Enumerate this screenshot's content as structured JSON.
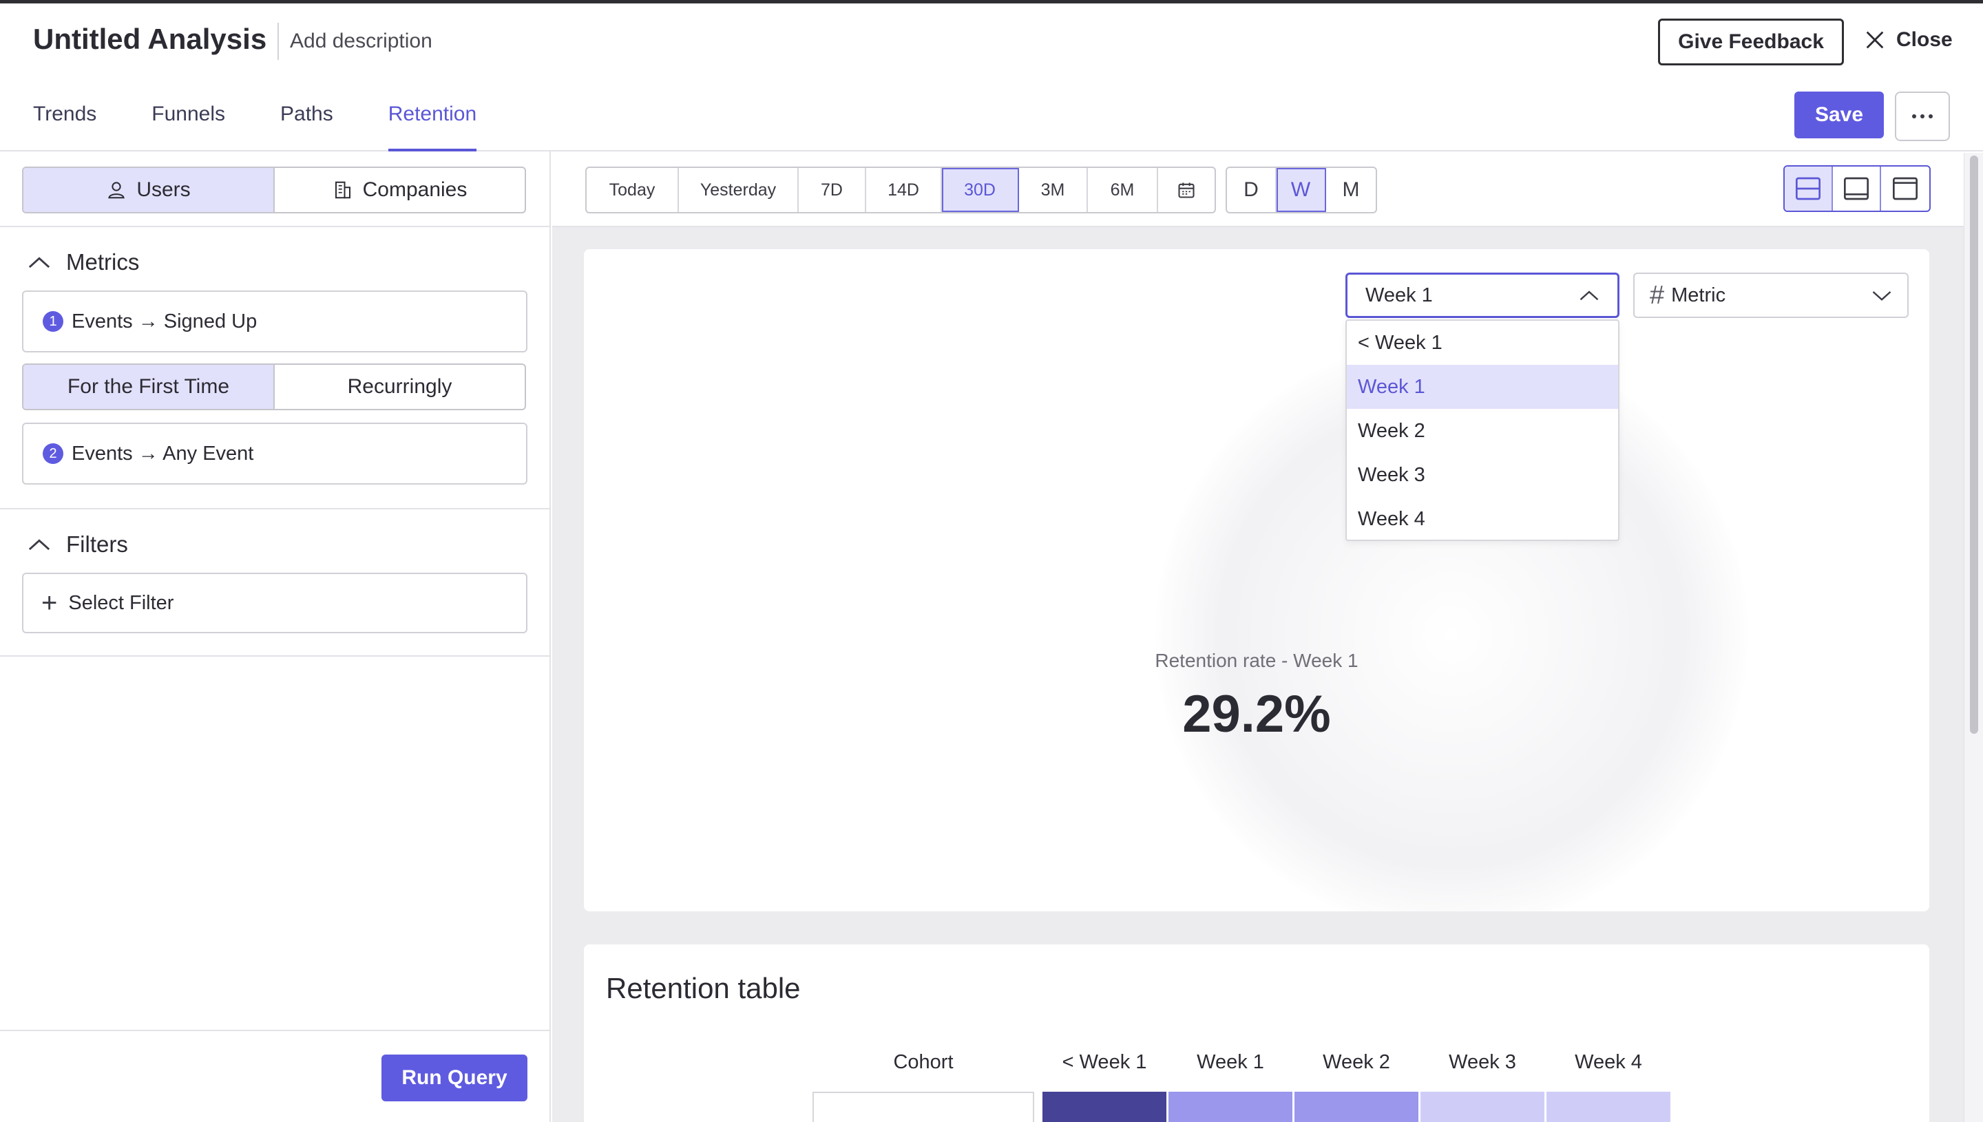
{
  "header": {
    "title": "Untitled Analysis",
    "description": "Add description",
    "feedback_label": "Give Feedback",
    "close_label": "Close",
    "save_label": "Save"
  },
  "tabs": [
    {
      "label": "Trends",
      "active": false
    },
    {
      "label": "Funnels",
      "active": false
    },
    {
      "label": "Paths",
      "active": false
    },
    {
      "label": "Retention",
      "active": true
    }
  ],
  "sidebar": {
    "entity_toggle": [
      {
        "label": "Users",
        "icon": "user-icon",
        "selected": true
      },
      {
        "label": "Companies",
        "icon": "building-icon",
        "selected": false
      }
    ],
    "metrics_title": "Metrics",
    "metric_1": {
      "number": "1",
      "label": "Events → Signed Up"
    },
    "occurrence_toggle": [
      {
        "label": "For the First Time",
        "selected": true
      },
      {
        "label": "Recurringly",
        "selected": false
      }
    ],
    "metric_2": {
      "number": "2",
      "label": "Events → Any Event"
    },
    "filters_title": "Filters",
    "select_filter_label": "Select Filter",
    "run_query_label": "Run Query"
  },
  "toolbar": {
    "date_ranges": [
      "Today",
      "Yesterday",
      "7D",
      "14D",
      "30D",
      "3M",
      "6M"
    ],
    "selected_range": "30D",
    "granularity": [
      "D",
      "W",
      "M"
    ],
    "selected_granularity": "W",
    "layout_icons": [
      "layout-split-icon",
      "layout-bottom-icon",
      "layout-top-icon"
    ]
  },
  "summary": {
    "period_select_value": "Week 1",
    "period_options": [
      "< Week 1",
      "Week 1",
      "Week 2",
      "Week 3",
      "Week 4"
    ],
    "selected_period": "Week 1",
    "metric_select_label": "Metric",
    "retention_label": "Retention rate - Week 1",
    "retention_value": "29.2%"
  },
  "retention_table": {
    "title": "Retention table",
    "columns": [
      "Cohort",
      "< Week 1",
      "Week 1",
      "Week 2",
      "Week 3",
      "Week 4"
    ],
    "first_row_colors": [
      "#464296",
      "#9a97ec",
      "#9a97ec",
      "#cfcdf7",
      "#cfcdf7"
    ]
  },
  "colors": {
    "accent": "#5f5be0",
    "selected_bg": "#e2e1fb"
  }
}
